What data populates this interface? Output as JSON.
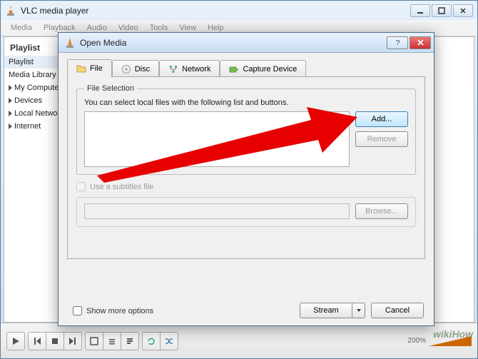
{
  "app": {
    "title": "VLC media player"
  },
  "menu": [
    "Media",
    "Playback",
    "Audio",
    "Video",
    "Tools",
    "View",
    "Help"
  ],
  "sidebar": {
    "header": "Playlist",
    "items": [
      {
        "label": "Playlist",
        "selected": true,
        "expand": false
      },
      {
        "label": "Media Library",
        "selected": false,
        "expand": false
      },
      {
        "label": "My Computer",
        "selected": false,
        "expand": true
      },
      {
        "label": "Devices",
        "selected": false,
        "expand": true
      },
      {
        "label": "Local Network",
        "selected": false,
        "expand": true
      },
      {
        "label": "Internet",
        "selected": false,
        "expand": true
      }
    ]
  },
  "dialog": {
    "title": "Open Media",
    "tabs": [
      {
        "label": "File",
        "icon": "folder",
        "active": true
      },
      {
        "label": "Disc",
        "icon": "disc",
        "active": false
      },
      {
        "label": "Network",
        "icon": "network",
        "active": false
      },
      {
        "label": "Capture Device",
        "icon": "capture",
        "active": false
      }
    ],
    "fileSelection": {
      "legend": "File Selection",
      "hint": "You can select local files with the following list and buttons.",
      "add": "Add...",
      "remove": "Remove"
    },
    "subtitles": {
      "check": "Use a subtitles file",
      "browse": "Browse..."
    },
    "showMore": "Show more options",
    "stream": "Stream",
    "cancel": "Cancel"
  },
  "volume": {
    "label": "200%"
  },
  "watermark": "wikiHow"
}
